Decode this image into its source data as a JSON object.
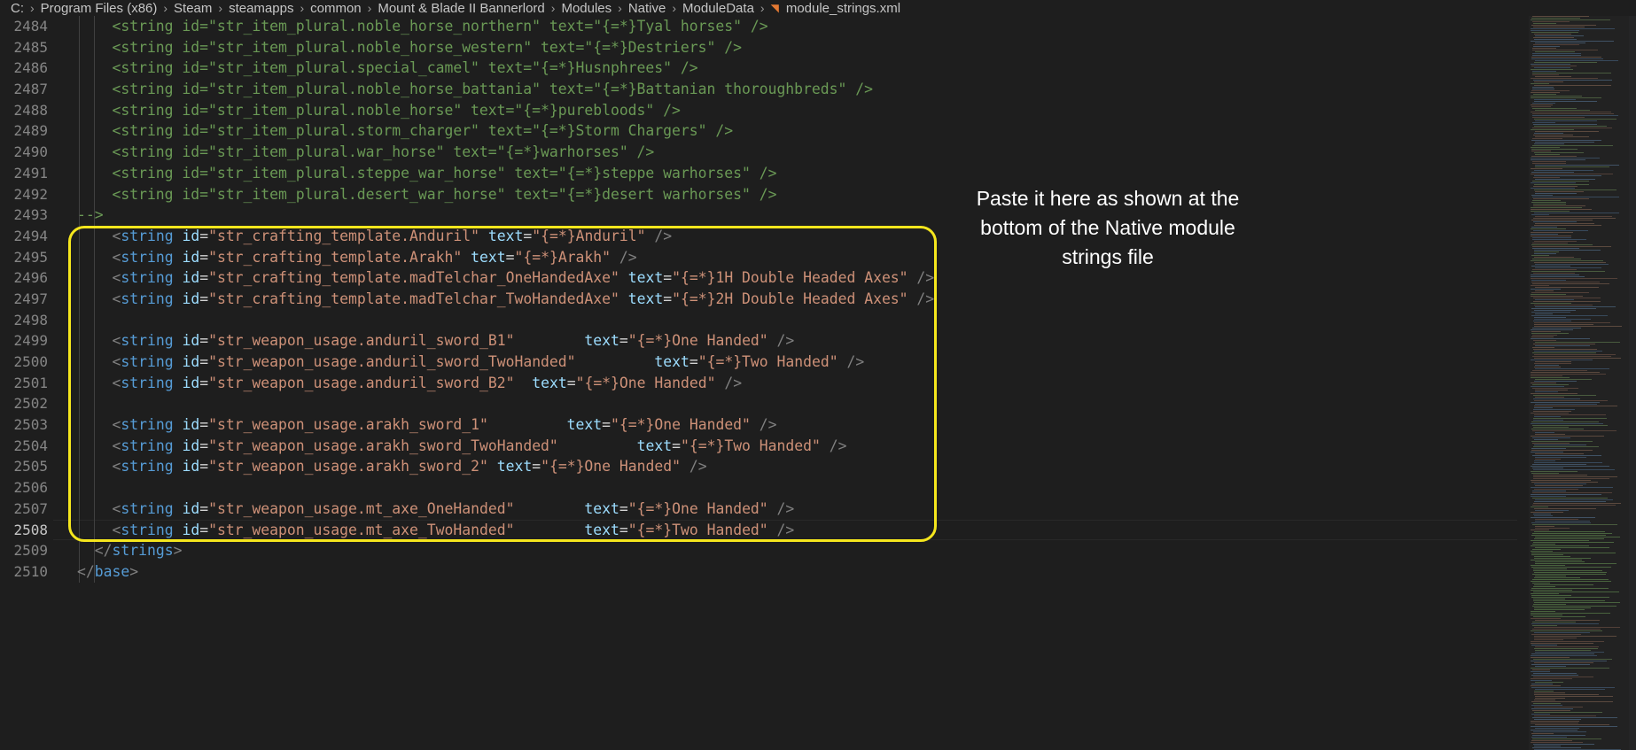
{
  "breadcrumb": {
    "segments": [
      "C:",
      "Program Files (x86)",
      "Steam",
      "steamapps",
      "common",
      "Mount & Blade II Bannerlord",
      "Modules",
      "Native",
      "ModuleData"
    ],
    "file": "module_strings.xml",
    "file_icon": "rss-icon"
  },
  "editor": {
    "active_line": "2508",
    "lines": [
      {
        "n": "2484",
        "tokens": [
          [
            "cmt",
            "    <string id=\"str_item_plural.noble_horse_northern\" text=\"{=*}Tyal horses\" />"
          ]
        ]
      },
      {
        "n": "2485",
        "tokens": [
          [
            "cmt",
            "    <string id=\"str_item_plural.noble_horse_western\" text=\"{=*}Destriers\" />"
          ]
        ]
      },
      {
        "n": "2486",
        "tokens": [
          [
            "cmt",
            "    <string id=\"str_item_plural.special_camel\" text=\"{=*}Husnphrees\" />"
          ]
        ]
      },
      {
        "n": "2487",
        "tokens": [
          [
            "cmt",
            "    <string id=\"str_item_plural.noble_horse_battania\" text=\"{=*}Battanian thoroughbreds\" />"
          ]
        ]
      },
      {
        "n": "2488",
        "tokens": [
          [
            "cmt",
            "    <string id=\"str_item_plural.noble_horse\" text=\"{=*}purebloods\" />"
          ]
        ]
      },
      {
        "n": "2489",
        "tokens": [
          [
            "cmt",
            "    <string id=\"str_item_plural.storm_charger\" text=\"{=*}Storm Chargers\" />"
          ]
        ]
      },
      {
        "n": "2490",
        "tokens": [
          [
            "cmt",
            "    <string id=\"str_item_plural.war_horse\" text=\"{=*}warhorses\" />"
          ]
        ]
      },
      {
        "n": "2491",
        "tokens": [
          [
            "cmt",
            "    <string id=\"str_item_plural.steppe_war_horse\" text=\"{=*}steppe warhorses\" />"
          ]
        ]
      },
      {
        "n": "2492",
        "tokens": [
          [
            "cmt",
            "    <string id=\"str_item_plural.desert_war_horse\" text=\"{=*}desert warhorses\" />"
          ]
        ]
      },
      {
        "n": "2493",
        "tokens": [
          [
            "cmt",
            "-->"
          ]
        ]
      },
      {
        "n": "2494",
        "tokens": [
          [
            "txt",
            "    "
          ],
          [
            "br",
            "<"
          ],
          [
            "tag",
            "string"
          ],
          [
            "txt",
            " "
          ],
          [
            "attr",
            "id"
          ],
          [
            "txt",
            "="
          ],
          [
            "str",
            "\"str_crafting_template.Anduril\""
          ],
          [
            "txt",
            " "
          ],
          [
            "attr",
            "text"
          ],
          [
            "txt",
            "="
          ],
          [
            "str",
            "\"{=*}Anduril\""
          ],
          [
            "txt",
            " "
          ],
          [
            "br",
            "/>"
          ]
        ]
      },
      {
        "n": "2495",
        "tokens": [
          [
            "txt",
            "    "
          ],
          [
            "br",
            "<"
          ],
          [
            "tag",
            "string"
          ],
          [
            "txt",
            " "
          ],
          [
            "attr",
            "id"
          ],
          [
            "txt",
            "="
          ],
          [
            "str",
            "\"str_crafting_template.Arakh\""
          ],
          [
            "txt",
            " "
          ],
          [
            "attr",
            "text"
          ],
          [
            "txt",
            "="
          ],
          [
            "str",
            "\"{=*}Arakh\""
          ],
          [
            "txt",
            " "
          ],
          [
            "br",
            "/>"
          ]
        ]
      },
      {
        "n": "2496",
        "tokens": [
          [
            "txt",
            "    "
          ],
          [
            "br",
            "<"
          ],
          [
            "tag",
            "string"
          ],
          [
            "txt",
            " "
          ],
          [
            "attr",
            "id"
          ],
          [
            "txt",
            "="
          ],
          [
            "str",
            "\"str_crafting_template.madTelchar_OneHandedAxe\""
          ],
          [
            "txt",
            " "
          ],
          [
            "attr",
            "text"
          ],
          [
            "txt",
            "="
          ],
          [
            "str",
            "\"{=*}1H Double Headed Axes\""
          ],
          [
            "txt",
            " "
          ],
          [
            "br",
            "/>"
          ]
        ]
      },
      {
        "n": "2497",
        "tokens": [
          [
            "txt",
            "    "
          ],
          [
            "br",
            "<"
          ],
          [
            "tag",
            "string"
          ],
          [
            "txt",
            " "
          ],
          [
            "attr",
            "id"
          ],
          [
            "txt",
            "="
          ],
          [
            "str",
            "\"str_crafting_template.madTelchar_TwoHandedAxe\""
          ],
          [
            "txt",
            " "
          ],
          [
            "attr",
            "text"
          ],
          [
            "txt",
            "="
          ],
          [
            "str",
            "\"{=*}2H Double Headed Axes\""
          ],
          [
            "txt",
            " "
          ],
          [
            "br",
            "/>"
          ]
        ]
      },
      {
        "n": "2498",
        "tokens": []
      },
      {
        "n": "2499",
        "tokens": [
          [
            "txt",
            "    "
          ],
          [
            "br",
            "<"
          ],
          [
            "tag",
            "string"
          ],
          [
            "txt",
            " "
          ],
          [
            "attr",
            "id"
          ],
          [
            "txt",
            "="
          ],
          [
            "str",
            "\"str_weapon_usage.anduril_sword_B1\""
          ],
          [
            "txt",
            "        "
          ],
          [
            "attr",
            "text"
          ],
          [
            "txt",
            "="
          ],
          [
            "str",
            "\"{=*}One Handed\""
          ],
          [
            "txt",
            " "
          ],
          [
            "br",
            "/>"
          ]
        ]
      },
      {
        "n": "2500",
        "tokens": [
          [
            "txt",
            "    "
          ],
          [
            "br",
            "<"
          ],
          [
            "tag",
            "string"
          ],
          [
            "txt",
            " "
          ],
          [
            "attr",
            "id"
          ],
          [
            "txt",
            "="
          ],
          [
            "str",
            "\"str_weapon_usage.anduril_sword_TwoHanded\""
          ],
          [
            "txt",
            "         "
          ],
          [
            "attr",
            "text"
          ],
          [
            "txt",
            "="
          ],
          [
            "str",
            "\"{=*}Two Handed\""
          ],
          [
            "txt",
            " "
          ],
          [
            "br",
            "/>"
          ]
        ]
      },
      {
        "n": "2501",
        "tokens": [
          [
            "txt",
            "    "
          ],
          [
            "br",
            "<"
          ],
          [
            "tag",
            "string"
          ],
          [
            "txt",
            " "
          ],
          [
            "attr",
            "id"
          ],
          [
            "txt",
            "="
          ],
          [
            "str",
            "\"str_weapon_usage.anduril_sword_B2\""
          ],
          [
            "txt",
            "  "
          ],
          [
            "attr",
            "text"
          ],
          [
            "txt",
            "="
          ],
          [
            "str",
            "\"{=*}One Handed\""
          ],
          [
            "txt",
            " "
          ],
          [
            "br",
            "/>"
          ]
        ]
      },
      {
        "n": "2502",
        "tokens": []
      },
      {
        "n": "2503",
        "tokens": [
          [
            "txt",
            "    "
          ],
          [
            "br",
            "<"
          ],
          [
            "tag",
            "string"
          ],
          [
            "txt",
            " "
          ],
          [
            "attr",
            "id"
          ],
          [
            "txt",
            "="
          ],
          [
            "str",
            "\"str_weapon_usage.arakh_sword_1\""
          ],
          [
            "txt",
            "         "
          ],
          [
            "attr",
            "text"
          ],
          [
            "txt",
            "="
          ],
          [
            "str",
            "\"{=*}One Handed\""
          ],
          [
            "txt",
            " "
          ],
          [
            "br",
            "/>"
          ]
        ]
      },
      {
        "n": "2504",
        "tokens": [
          [
            "txt",
            "    "
          ],
          [
            "br",
            "<"
          ],
          [
            "tag",
            "string"
          ],
          [
            "txt",
            " "
          ],
          [
            "attr",
            "id"
          ],
          [
            "txt",
            "="
          ],
          [
            "str",
            "\"str_weapon_usage.arakh_sword_TwoHanded\""
          ],
          [
            "txt",
            "         "
          ],
          [
            "attr",
            "text"
          ],
          [
            "txt",
            "="
          ],
          [
            "str",
            "\"{=*}Two Handed\""
          ],
          [
            "txt",
            " "
          ],
          [
            "br",
            "/>"
          ]
        ]
      },
      {
        "n": "2505",
        "tokens": [
          [
            "txt",
            "    "
          ],
          [
            "br",
            "<"
          ],
          [
            "tag",
            "string"
          ],
          [
            "txt",
            " "
          ],
          [
            "attr",
            "id"
          ],
          [
            "txt",
            "="
          ],
          [
            "str",
            "\"str_weapon_usage.arakh_sword_2\""
          ],
          [
            "txt",
            " "
          ],
          [
            "attr",
            "text"
          ],
          [
            "txt",
            "="
          ],
          [
            "str",
            "\"{=*}One Handed\""
          ],
          [
            "txt",
            " "
          ],
          [
            "br",
            "/>"
          ]
        ]
      },
      {
        "n": "2506",
        "tokens": []
      },
      {
        "n": "2507",
        "tokens": [
          [
            "txt",
            "    "
          ],
          [
            "br",
            "<"
          ],
          [
            "tag",
            "string"
          ],
          [
            "txt",
            " "
          ],
          [
            "attr",
            "id"
          ],
          [
            "txt",
            "="
          ],
          [
            "str",
            "\"str_weapon_usage.mt_axe_OneHanded\""
          ],
          [
            "txt",
            "        "
          ],
          [
            "attr",
            "text"
          ],
          [
            "txt",
            "="
          ],
          [
            "str",
            "\"{=*}One Handed\""
          ],
          [
            "txt",
            " "
          ],
          [
            "br",
            "/>"
          ]
        ]
      },
      {
        "n": "2508",
        "tokens": [
          [
            "txt",
            "    "
          ],
          [
            "br",
            "<"
          ],
          [
            "tag",
            "string"
          ],
          [
            "txt",
            " "
          ],
          [
            "attr",
            "id"
          ],
          [
            "txt",
            "="
          ],
          [
            "str",
            "\"str_weapon_usage.mt_axe_TwoHanded\""
          ],
          [
            "txt",
            "        "
          ],
          [
            "attr",
            "text"
          ],
          [
            "txt",
            "="
          ],
          [
            "str",
            "\"{=*}Two Handed\""
          ],
          [
            "txt",
            " "
          ],
          [
            "br",
            "/>"
          ]
        ]
      },
      {
        "n": "2509",
        "tokens": [
          [
            "txt",
            "  "
          ],
          [
            "br",
            "</"
          ],
          [
            "tag",
            "strings"
          ],
          [
            "br",
            ">"
          ]
        ]
      },
      {
        "n": "2510",
        "tokens": [
          [
            "br",
            "</"
          ],
          [
            "tag",
            "base"
          ],
          [
            "br",
            ">"
          ]
        ]
      }
    ]
  },
  "annotation": {
    "text": "Paste it here as shown at the bottom of the Native module strings file"
  },
  "colors": {
    "background": "#1e1e1e",
    "highlight_border": "#f5e61d",
    "comment": "#6a9955",
    "tag": "#569cd6",
    "attribute": "#9cdcfe",
    "string": "#ce9178"
  }
}
